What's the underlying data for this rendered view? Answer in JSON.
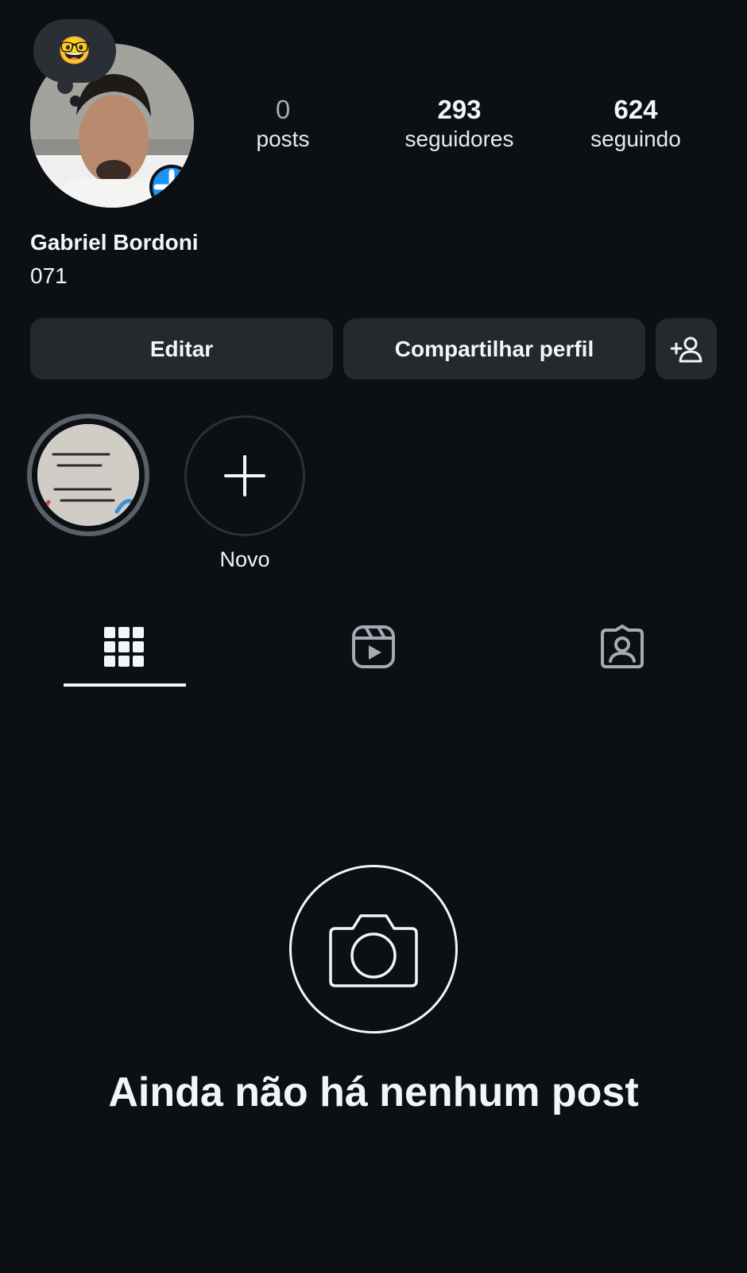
{
  "profile": {
    "name": "Gabriel Bordoni",
    "bio": "071",
    "note_emoji": "🤓"
  },
  "stats": [
    {
      "value": "0",
      "label": "posts"
    },
    {
      "value": "293",
      "label": "seguidores"
    },
    {
      "value": "624",
      "label": "seguindo"
    }
  ],
  "actions": {
    "edit_label": "Editar",
    "share_label": "Compartilhar perfil"
  },
  "highlights": {
    "new_label": "Novo"
  },
  "tabs": [
    "grid-icon",
    "reels-icon",
    "tagged-icon"
  ],
  "empty_state": {
    "title": "Ainda não há nenhum post"
  },
  "colors": {
    "background": "#0c0f14",
    "button": "#25282d",
    "accent": "#1a94f7"
  }
}
